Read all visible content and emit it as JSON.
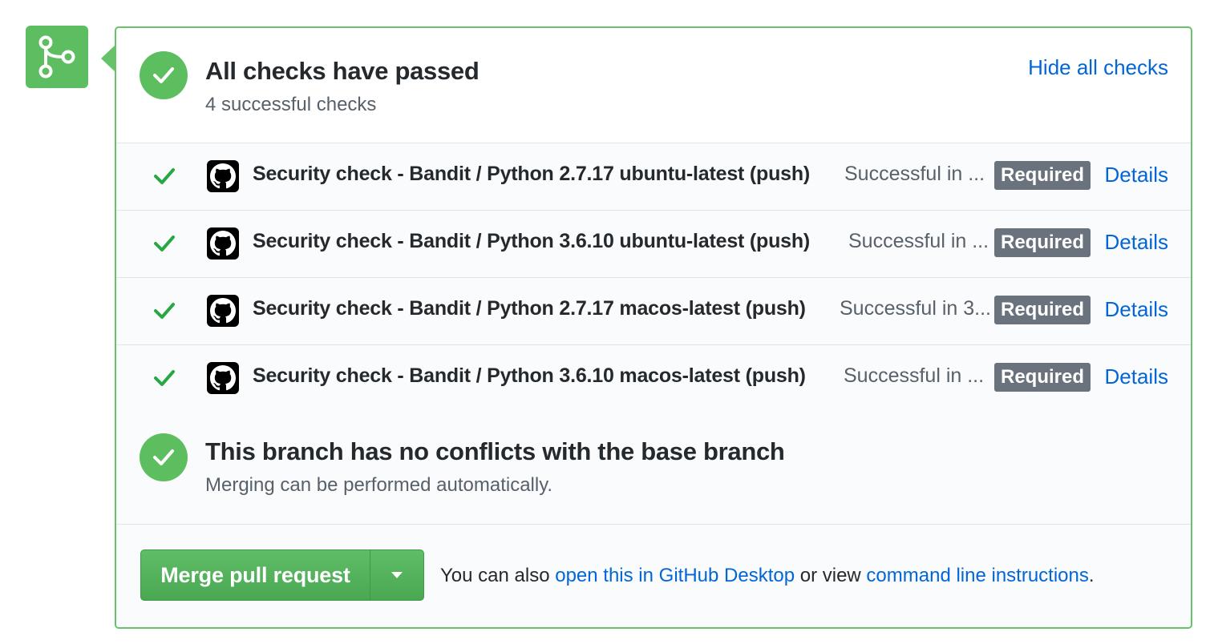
{
  "checks_header": {
    "title": "All checks have passed",
    "subtitle": "4 successful checks",
    "toggle_label": "Hide all checks"
  },
  "checks": [
    {
      "name": "Security check - Bandit / Python 2.7.17 ubuntu-latest (push)",
      "status": "Successful in ...",
      "badge": "Required",
      "link": "Details"
    },
    {
      "name": "Security check - Bandit / Python 3.6.10 ubuntu-latest (push)",
      "status": "Successful in ...",
      "badge": "Required",
      "link": "Details"
    },
    {
      "name": "Security check - Bandit / Python 2.7.17 macos-latest (push)",
      "status": "Successful in 3...",
      "badge": "Required",
      "link": "Details"
    },
    {
      "name": "Security check - Bandit / Python 3.6.10 macos-latest (push)",
      "status": "Successful in ...",
      "badge": "Required",
      "link": "Details"
    }
  ],
  "conflicts": {
    "title": "This branch has no conflicts with the base branch",
    "subtitle": "Merging can be performed automatically."
  },
  "merge": {
    "button_label": "Merge pull request",
    "hint_prefix": "You can also ",
    "hint_link1": "open this in GitHub Desktop",
    "hint_middle": " or view ",
    "hint_link2": "command line instructions",
    "hint_suffix": "."
  },
  "icons": {
    "merge_state": "git-merge-icon",
    "status": "check-circle-icon",
    "row_check": "check-icon",
    "avatar": "github-logo-icon",
    "dropdown": "triangle-down-icon"
  },
  "colors": {
    "success": "#5dbe60",
    "border": "#67c26a",
    "link": "#0366d6",
    "badge": "#6a737d",
    "button": "#4aa853"
  }
}
